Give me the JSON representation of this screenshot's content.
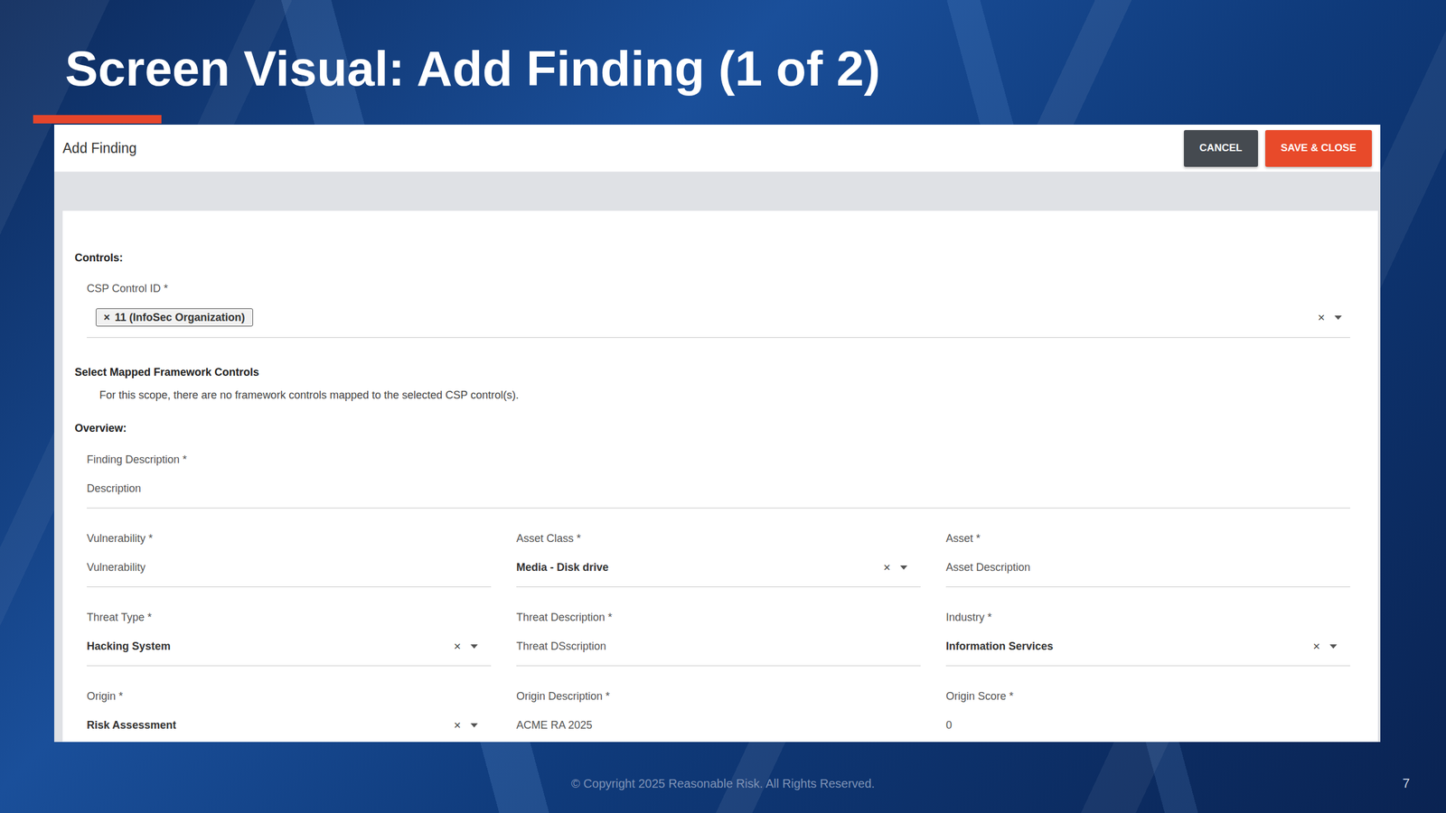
{
  "slide": {
    "title": "Screen Visual: Add Finding (1 of 2)",
    "footer": "© Copyright 2025 Reasonable Risk. All Rights Reserved.",
    "page_number": "7"
  },
  "dialog": {
    "title": "Add Finding",
    "buttons": [
      {
        "label": "CANCEL",
        "kind": "secondary"
      },
      {
        "label": "SAVE & CLOSE",
        "kind": "primary"
      }
    ],
    "controls": {
      "heading": "Controls:",
      "label": "CSP Control ID *",
      "chips": [
        {
          "remove": "×",
          "label": "11 (InfoSec Organization)"
        }
      ],
      "clear": "×"
    },
    "mapped": {
      "heading": "Select Mapped Framework Controls",
      "message": "For this scope, there are no framework controls mapped to the selected CSP control(s)."
    },
    "overview": {
      "heading": "Overview:",
      "description": {
        "label": "Finding Description *",
        "value": "Description"
      },
      "fields": [
        {
          "label": "Vulnerability *",
          "value": "Vulnerability",
          "kind": "text"
        },
        {
          "label": "Asset Class *",
          "value": "Media - Disk drive",
          "kind": "select",
          "clear": "×"
        },
        {
          "label": "Asset *",
          "value": "Asset Description",
          "kind": "text"
        },
        {
          "label": "Threat Type *",
          "value": "Hacking System",
          "kind": "select",
          "clear": "×"
        },
        {
          "label": "Threat Description *",
          "value": "Threat DSscription",
          "kind": "text"
        },
        {
          "label": "Industry *",
          "value": "Information Services",
          "kind": "select",
          "clear": "×"
        },
        {
          "label": "Origin *",
          "value": "Risk Assessment",
          "kind": "select",
          "clear": "×"
        },
        {
          "label": "Origin Description *",
          "value": "ACME RA 2025",
          "kind": "text"
        },
        {
          "label": "Origin Score *",
          "value": "0",
          "kind": "text"
        }
      ]
    }
  }
}
